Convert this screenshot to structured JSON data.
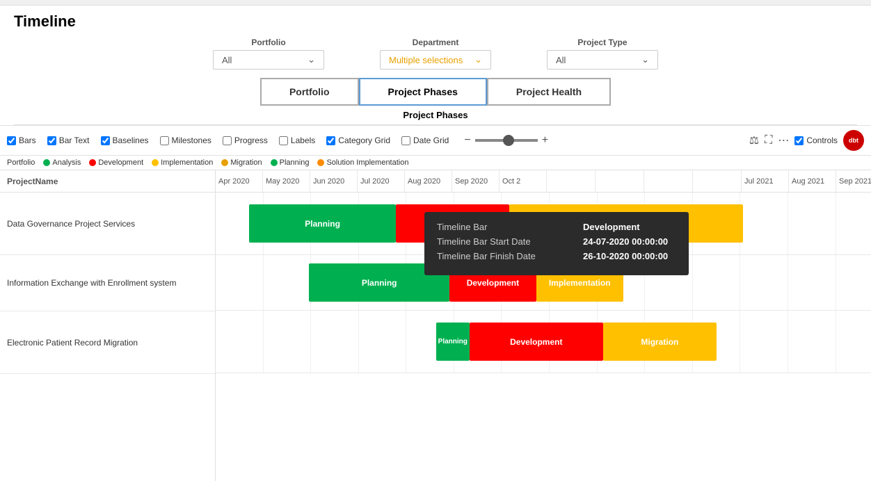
{
  "page": {
    "title": "Timeline",
    "topbar_color": "#f0f0f0"
  },
  "filters": {
    "portfolio": {
      "label": "Portfolio",
      "value": "All",
      "type": "single"
    },
    "department": {
      "label": "Department",
      "value": "Multiple selections",
      "type": "multi"
    },
    "project_type": {
      "label": "Project Type",
      "value": "All",
      "type": "single"
    }
  },
  "nav_tabs": [
    {
      "id": "portfolio",
      "label": "Portfolio",
      "active": false
    },
    {
      "id": "project-phases",
      "label": "Project Phases",
      "active": true
    },
    {
      "id": "project-health",
      "label": "Project Health",
      "active": false
    }
  ],
  "section_label": "Project Phases",
  "toolbar": {
    "checkboxes": [
      {
        "id": "bars",
        "label": "Bars",
        "checked": true
      },
      {
        "id": "bar-text",
        "label": "Bar Text",
        "checked": true
      },
      {
        "id": "baselines",
        "label": "Baselines",
        "checked": true
      },
      {
        "id": "milestones",
        "label": "Milestones",
        "checked": false
      },
      {
        "id": "progress",
        "label": "Progress",
        "checked": false
      },
      {
        "id": "labels",
        "label": "Labels",
        "checked": false
      },
      {
        "id": "category-grid",
        "label": "Category Grid",
        "checked": true
      },
      {
        "id": "date-grid",
        "label": "Date Grid",
        "checked": false
      }
    ],
    "controls_label": "Controls",
    "controls_checked": true,
    "brand": "dbt"
  },
  "legend": {
    "portfolio_label": "Portfolio",
    "items": [
      {
        "id": "analysis",
        "label": "Analysis",
        "color": "#00b050"
      },
      {
        "id": "development",
        "label": "Development",
        "color": "#ff0000"
      },
      {
        "id": "implementation",
        "label": "Implementation",
        "color": "#ffc000"
      },
      {
        "id": "migration",
        "label": "Migration",
        "color": "#e8a000"
      },
      {
        "id": "planning",
        "label": "Planning",
        "color": "#00b050"
      },
      {
        "id": "solution-impl",
        "label": "Solution Implementation",
        "color": "#ff8c00"
      }
    ]
  },
  "table": {
    "col_header": "ProjectName",
    "months": [
      "Apr 2020",
      "May 2020",
      "Jun 2020",
      "Jul 2020",
      "Aug 2020",
      "Sep 2020",
      "Oct 2",
      "",
      "",
      "",
      "",
      "Jul 2021",
      "Aug 2021",
      "Sep 2021"
    ],
    "projects": [
      {
        "id": "proj1",
        "name": "Data Governance Project Services",
        "bars": [
          {
            "label": "Planning",
            "type": "planning",
            "left_pct": 8,
            "width_pct": 21
          },
          {
            "label": "Development",
            "type": "development",
            "left_pct": 29,
            "width_pct": 18
          },
          {
            "label": "",
            "type": "implementation",
            "left_pct": 47,
            "width_pct": 33
          }
        ]
      },
      {
        "id": "proj2",
        "name": "Information Exchange with Enrollment system",
        "bars": [
          {
            "label": "Planning",
            "type": "planning",
            "left_pct": 14,
            "width_pct": 20
          },
          {
            "label": "Development",
            "type": "development",
            "left_pct": 34,
            "width_pct": 13
          },
          {
            "label": "Implementation",
            "type": "implementation",
            "left_pct": 47,
            "width_pct": 13
          }
        ]
      },
      {
        "id": "proj3",
        "name": "Electronic Patient Record Migration",
        "bars": [
          {
            "label": "Planning",
            "type": "planning",
            "left_pct": 33,
            "width_pct": 5
          },
          {
            "label": "Development",
            "type": "development",
            "left_pct": 38,
            "width_pct": 19
          },
          {
            "label": "Migration",
            "type": "migration",
            "left_pct": 57,
            "width_pct": 16
          }
        ]
      }
    ]
  },
  "tooltip": {
    "rows": [
      {
        "label": "Timeline Bar",
        "value": "Development"
      },
      {
        "label": "Timeline Bar Start Date",
        "value": "24-07-2020 00:00:00"
      },
      {
        "label": "Timeline Bar Finish Date",
        "value": "26-10-2020 00:00:00"
      }
    ]
  },
  "icons": {
    "filter": "⊞",
    "expand": "⛶",
    "more": "…"
  }
}
